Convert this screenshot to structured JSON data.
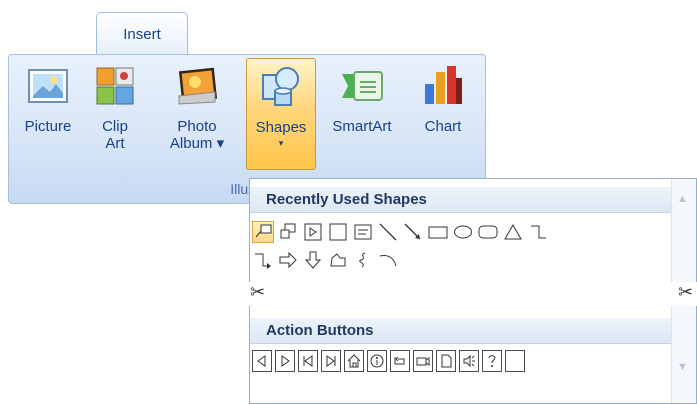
{
  "ribbon": {
    "tab_label": "Insert",
    "group_label": "Illustr",
    "buttons": [
      {
        "id": "picture",
        "line1": "Picture",
        "line2": ""
      },
      {
        "id": "clip-art",
        "line1": "Clip",
        "line2": "Art"
      },
      {
        "id": "photo-album",
        "line1": "Photo",
        "line2": "Album ▾"
      },
      {
        "id": "shapes",
        "line1": "Shapes",
        "line2": "▾"
      },
      {
        "id": "smartart",
        "line1": "SmartArt",
        "line2": ""
      },
      {
        "id": "chart",
        "line1": "Chart",
        "line2": ""
      }
    ]
  },
  "gallery": {
    "section1_title": "Recently Used Shapes",
    "section2_title": "Action Buttons",
    "scissor_glyph": "✂",
    "scroll_up": "▲",
    "scroll_down": "▼"
  }
}
